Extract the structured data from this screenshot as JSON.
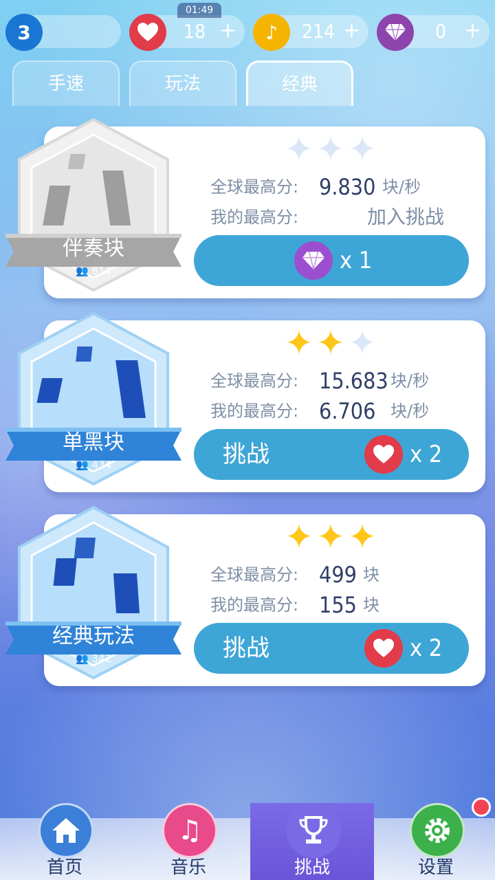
{
  "status": {
    "time": "01:49"
  },
  "currencies": {
    "level": "3",
    "hearts": {
      "value": "18",
      "icon": "heart-icon"
    },
    "notes": {
      "value": "214",
      "icon": "music-note-icon"
    },
    "gems": {
      "value": "0",
      "icon": "diamond-icon"
    },
    "plus": "+"
  },
  "tabs": [
    {
      "label": "手速"
    },
    {
      "label": "玩法"
    },
    {
      "label": "经典",
      "active": true
    }
  ],
  "modes": [
    {
      "name": "伴奏块",
      "players": "814",
      "stars": 0,
      "global_label": "全球最高分:",
      "global_value": "9.830",
      "global_unit": "块/秒",
      "my_label": "我的最高分:",
      "my_value": "",
      "my_unit": "",
      "join_text": "加入挑战",
      "action_label": "",
      "cost": "x 1",
      "cost_icon": "diamond-icon",
      "locked": true
    },
    {
      "name": "单黑块",
      "players": "434",
      "stars": 2,
      "global_label": "全球最高分:",
      "global_value": "15.683",
      "global_unit": "块/秒",
      "my_label": "我的最高分:",
      "my_value": "6.706",
      "my_unit": "块/秒",
      "join_text": "",
      "action_label": "挑战",
      "cost": "x 2",
      "cost_icon": "heart-icon"
    },
    {
      "name": "经典玩法",
      "players": "342",
      "stars": 3,
      "global_label": "全球最高分:",
      "global_value": "499",
      "global_unit": "块",
      "my_label": "我的最高分:",
      "my_value": "155",
      "my_unit": "块",
      "join_text": "",
      "action_label": "挑战",
      "cost": "x 2",
      "cost_icon": "heart-icon"
    }
  ],
  "nav": [
    {
      "label": "首页",
      "icon": "home-icon",
      "color": "#3b7fd9"
    },
    {
      "label": "音乐",
      "icon": "music-note-icon",
      "color": "#e84a8a"
    },
    {
      "label": "挑战",
      "icon": "trophy-icon",
      "color": "#7b6ae6",
      "active": true
    },
    {
      "label": "设置",
      "icon": "gear-icon",
      "color": "#3cb04a",
      "notification": true
    }
  ],
  "colors": {
    "accent_button": "#3ea6d6",
    "star_on": "#ffc61a",
    "heart": "#e23b4a",
    "diamond": "#8e44ad"
  }
}
